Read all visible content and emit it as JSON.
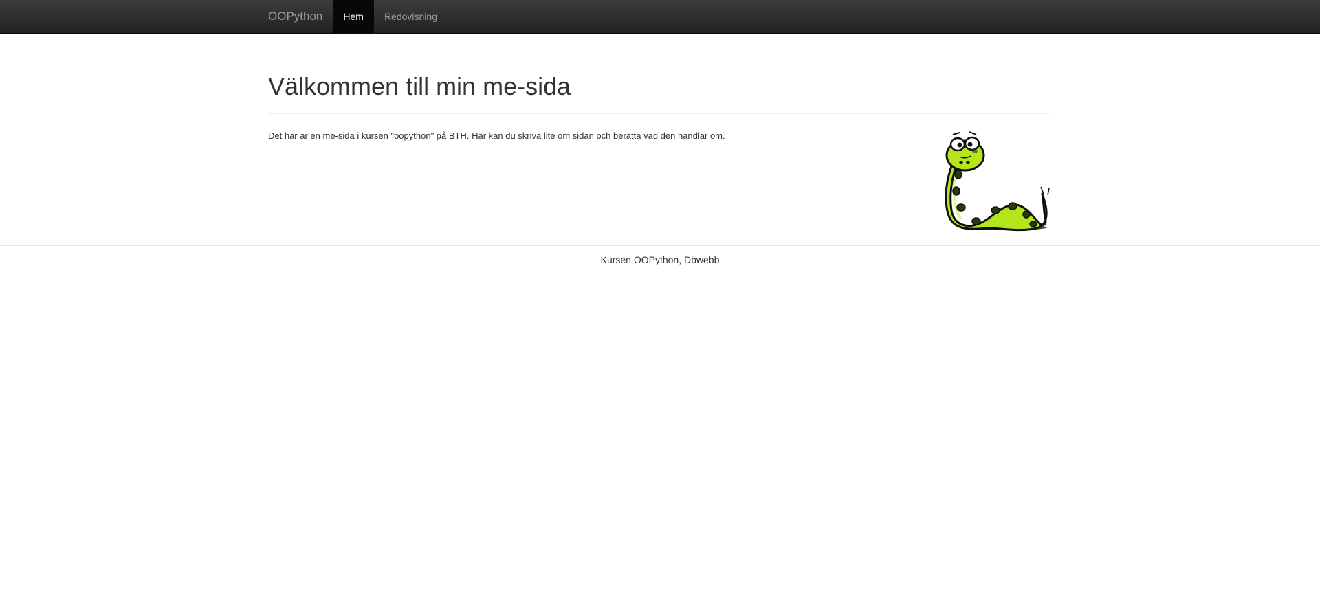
{
  "navbar": {
    "brand": "OOPython",
    "items": [
      {
        "label": "Hem",
        "active": true
      },
      {
        "label": "Redovisning",
        "active": false
      }
    ]
  },
  "main": {
    "title": "Välkommen till min me-sida",
    "intro": "Det här är en me-sida i kursen \"oopython\" på BTH. Här kan du skriva lite om sidan och berätta vad den handlar om.",
    "image": {
      "icon": "python-snake-mascot-icon"
    }
  },
  "footer": {
    "text": "Kursen OOPython, Dbwebb"
  },
  "colors": {
    "navbar_top": "#3c3c3c",
    "navbar_bottom": "#222222",
    "nav_active_bg": "#080808",
    "nav_text": "#9d9d9d",
    "snake_green": "#b5e61d"
  }
}
